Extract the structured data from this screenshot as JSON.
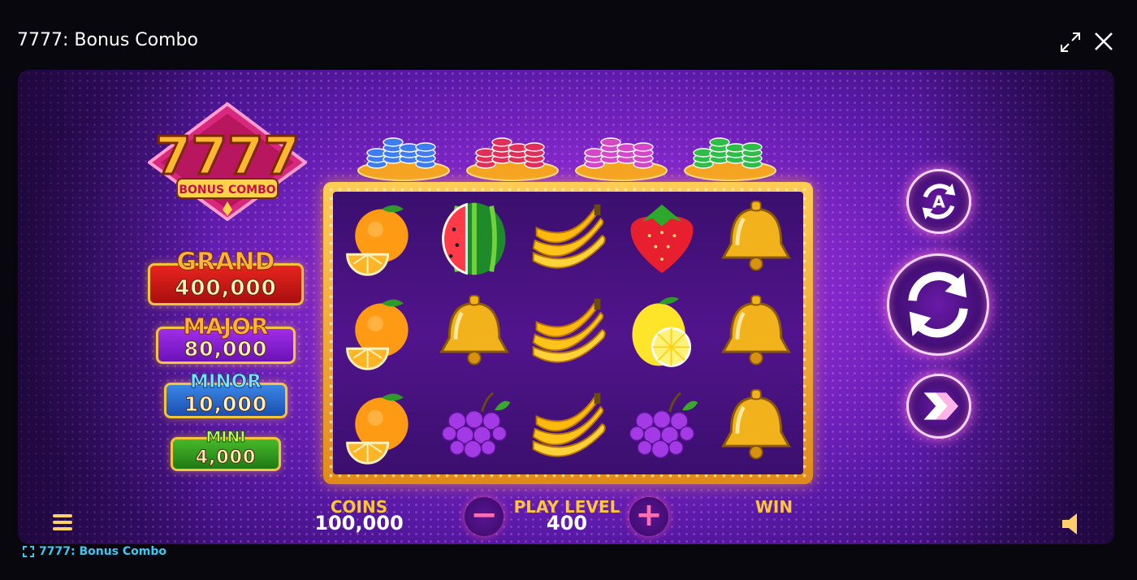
{
  "window": {
    "title": "7777: Bonus Combo"
  },
  "logo": {
    "number": "7777",
    "subtitle": "BONUS COMBO"
  },
  "jackpots": [
    {
      "name": "GRAND",
      "value": "400,000"
    },
    {
      "name": "MAJOR",
      "value": "80,000"
    },
    {
      "name": "MINOR",
      "value": "10,000"
    },
    {
      "name": "MINI",
      "value": "4,000"
    }
  ],
  "chip_colors": [
    "#3d7df0",
    "#e0305a",
    "#d447c8",
    "#2fbd4a"
  ],
  "reels": {
    "symbols": [
      [
        "orange",
        "watermelon",
        "banana",
        "strawberry",
        "bell"
      ],
      [
        "orange",
        "bell",
        "banana",
        "lemon",
        "bell"
      ],
      [
        "orange",
        "grapes",
        "banana",
        "grapes",
        "bell"
      ]
    ]
  },
  "controls": {
    "autoplay_icon": "autoplay-icon",
    "spin_icon": "spin-icon",
    "turbo_icon": "turbo-icon",
    "menu_icon": "hamburger-menu-icon",
    "sound_icon": "speaker-icon"
  },
  "hud": {
    "coins_label": "COINS",
    "coins_value": "100,000",
    "level_label": "PLAY LEVEL",
    "level_value": "400",
    "win_label": "WIN",
    "minus": "−",
    "plus": "+"
  },
  "footer": {
    "text": "7777: Bonus Combo"
  }
}
